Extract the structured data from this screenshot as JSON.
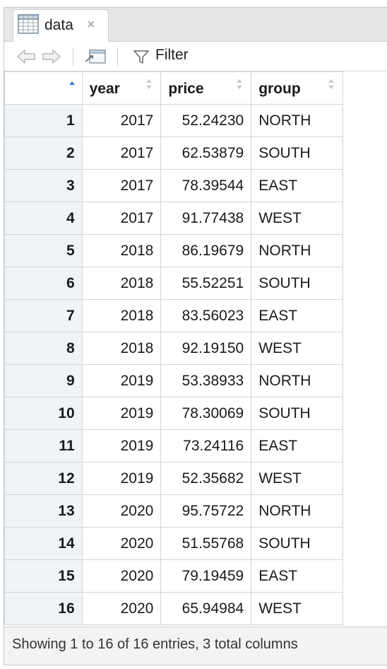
{
  "tab": {
    "title": "data",
    "close": "×",
    "icon": "table-grid-icon"
  },
  "toolbar": {
    "back_icon": "back-arrow-icon",
    "forward_icon": "forward-arrow-icon",
    "popout_icon": "show-in-new-window-icon",
    "filter_icon": "filter-funnel-icon",
    "filter_label": "Filter"
  },
  "table": {
    "columns": [
      "year",
      "price",
      "group"
    ],
    "rows": [
      {
        "n": "1",
        "year": "2017",
        "price": "52.24230",
        "group": "NORTH"
      },
      {
        "n": "2",
        "year": "2017",
        "price": "62.53879",
        "group": "SOUTH"
      },
      {
        "n": "3",
        "year": "2017",
        "price": "78.39544",
        "group": "EAST"
      },
      {
        "n": "4",
        "year": "2017",
        "price": "91.77438",
        "group": "WEST"
      },
      {
        "n": "5",
        "year": "2018",
        "price": "86.19679",
        "group": "NORTH"
      },
      {
        "n": "6",
        "year": "2018",
        "price": "55.52251",
        "group": "SOUTH"
      },
      {
        "n": "7",
        "year": "2018",
        "price": "83.56023",
        "group": "EAST"
      },
      {
        "n": "8",
        "year": "2018",
        "price": "92.19150",
        "group": "WEST"
      },
      {
        "n": "9",
        "year": "2019",
        "price": "53.38933",
        "group": "NORTH"
      },
      {
        "n": "10",
        "year": "2019",
        "price": "78.30069",
        "group": "SOUTH"
      },
      {
        "n": "11",
        "year": "2019",
        "price": "73.24116",
        "group": "EAST"
      },
      {
        "n": "12",
        "year": "2019",
        "price": "52.35682",
        "group": "WEST"
      },
      {
        "n": "13",
        "year": "2020",
        "price": "95.75722",
        "group": "NORTH"
      },
      {
        "n": "14",
        "year": "2020",
        "price": "51.55768",
        "group": "SOUTH"
      },
      {
        "n": "15",
        "year": "2020",
        "price": "79.19459",
        "group": "EAST"
      },
      {
        "n": "16",
        "year": "2020",
        "price": "65.94984",
        "group": "WEST"
      }
    ]
  },
  "footer": {
    "status": "Showing 1 to 16 of 16 entries, 3 total columns"
  },
  "colors": {
    "accent_sort": "#2f7fd6",
    "rownum_bg": "#f0f4f7",
    "tab_strip": "#e7e7e7"
  }
}
